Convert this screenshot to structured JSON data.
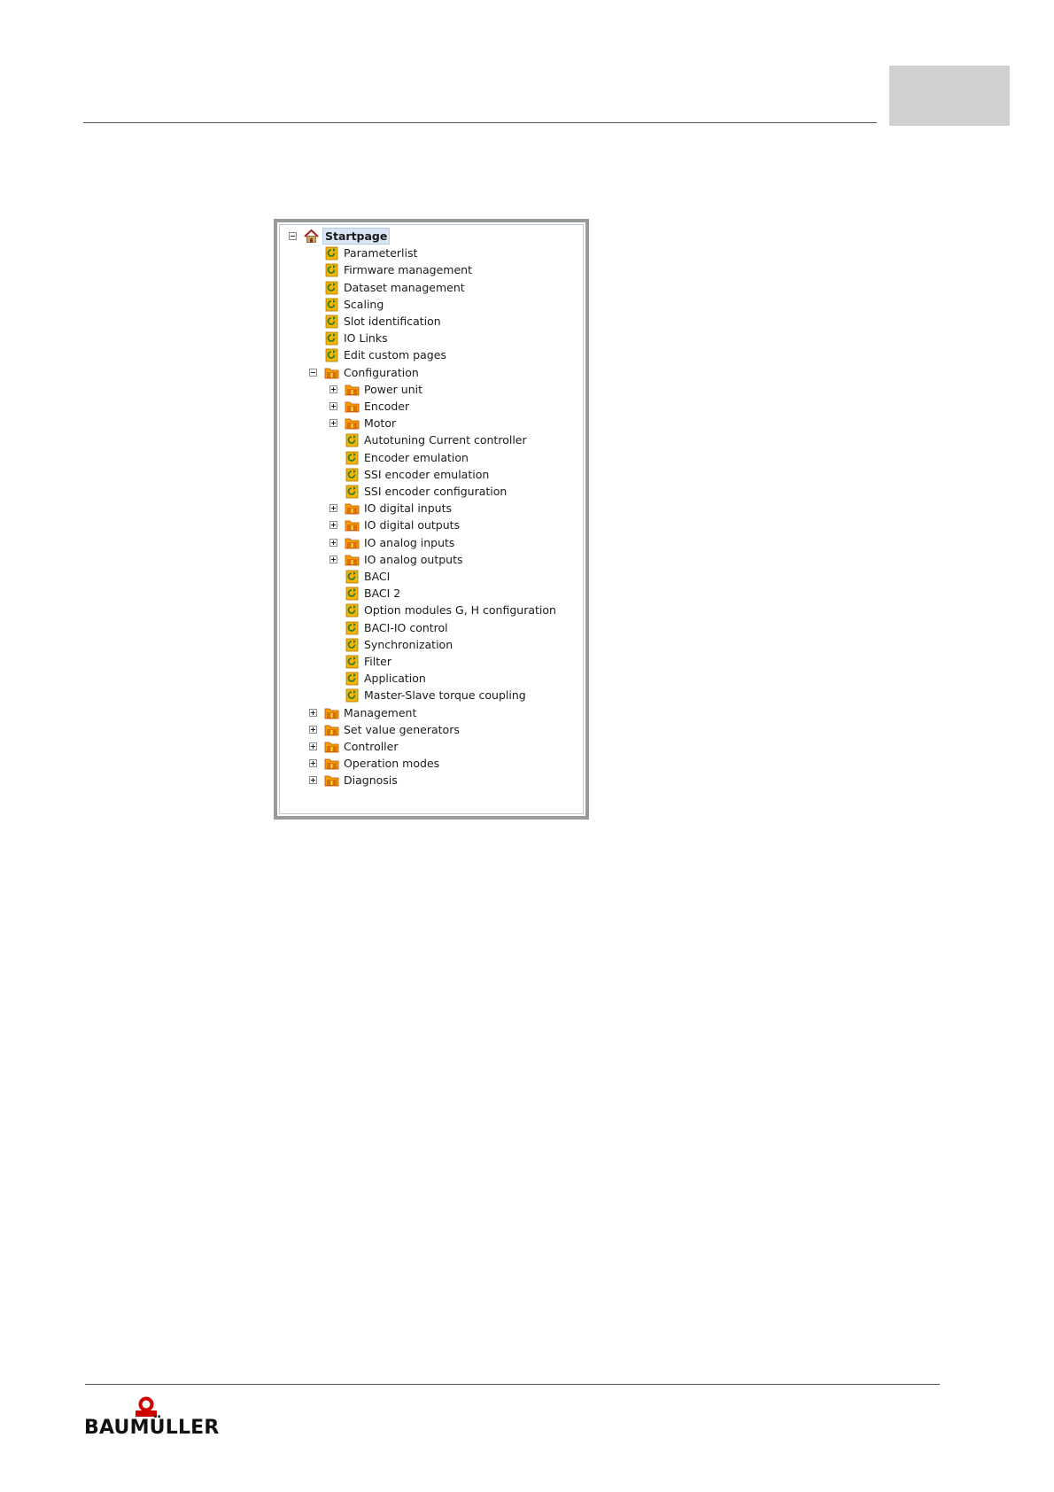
{
  "logo": {
    "text": "BAUMÜLLER"
  },
  "tree": {
    "root": {
      "label": "Startpage",
      "icon": "house-icon",
      "expanded": true
    },
    "items": [
      {
        "label": "Parameterlist",
        "icon": "page-icon",
        "level": 1,
        "toggle": "none"
      },
      {
        "label": "Firmware management",
        "icon": "page-icon",
        "level": 1,
        "toggle": "none"
      },
      {
        "label": "Dataset management",
        "icon": "page-icon",
        "level": 1,
        "toggle": "none"
      },
      {
        "label": "Scaling",
        "icon": "page-icon",
        "level": 1,
        "toggle": "none"
      },
      {
        "label": "Slot identification",
        "icon": "page-icon",
        "level": 1,
        "toggle": "none"
      },
      {
        "label": "IO Links",
        "icon": "page-icon",
        "level": 1,
        "toggle": "none"
      },
      {
        "label": "Edit custom pages",
        "icon": "page-icon",
        "level": 1,
        "toggle": "none"
      },
      {
        "label": "Configuration",
        "icon": "folder-icon",
        "level": 1,
        "toggle": "minus"
      },
      {
        "label": "Power unit",
        "icon": "folder-icon",
        "level": 2,
        "toggle": "plus"
      },
      {
        "label": "Encoder",
        "icon": "folder-icon",
        "level": 2,
        "toggle": "plus"
      },
      {
        "label": "Motor",
        "icon": "folder-icon",
        "level": 2,
        "toggle": "plus"
      },
      {
        "label": "Autotuning Current controller",
        "icon": "page-icon",
        "level": 2,
        "toggle": "none"
      },
      {
        "label": "Encoder emulation",
        "icon": "page-icon",
        "level": 2,
        "toggle": "none"
      },
      {
        "label": "SSI encoder emulation",
        "icon": "page-icon",
        "level": 2,
        "toggle": "none"
      },
      {
        "label": "SSI encoder configuration",
        "icon": "page-icon",
        "level": 2,
        "toggle": "none"
      },
      {
        "label": "IO digital inputs",
        "icon": "folder-icon",
        "level": 2,
        "toggle": "plus"
      },
      {
        "label": "IO digital outputs",
        "icon": "folder-icon",
        "level": 2,
        "toggle": "plus"
      },
      {
        "label": "IO analog inputs",
        "icon": "folder-icon",
        "level": 2,
        "toggle": "plus"
      },
      {
        "label": "IO analog outputs",
        "icon": "folder-icon",
        "level": 2,
        "toggle": "plus"
      },
      {
        "label": "BACI",
        "icon": "page-icon",
        "level": 2,
        "toggle": "none"
      },
      {
        "label": "BACI 2",
        "icon": "page-icon",
        "level": 2,
        "toggle": "none"
      },
      {
        "label": "Option modules G, H configuration",
        "icon": "page-icon",
        "level": 2,
        "toggle": "none"
      },
      {
        "label": "BACI-IO control",
        "icon": "page-icon",
        "level": 2,
        "toggle": "none"
      },
      {
        "label": "Synchronization",
        "icon": "page-icon",
        "level": 2,
        "toggle": "none"
      },
      {
        "label": "Filter",
        "icon": "page-icon",
        "level": 2,
        "toggle": "none"
      },
      {
        "label": "Application",
        "icon": "page-icon",
        "level": 2,
        "toggle": "none"
      },
      {
        "label": "Master-Slave torque coupling",
        "icon": "page-icon",
        "level": 2,
        "toggle": "none"
      },
      {
        "label": "Management",
        "icon": "folder-icon",
        "level": 1,
        "toggle": "plus"
      },
      {
        "label": "Set value generators",
        "icon": "folder-icon",
        "level": 1,
        "toggle": "plus"
      },
      {
        "label": "Controller",
        "icon": "folder-icon",
        "level": 1,
        "toggle": "plus"
      },
      {
        "label": "Operation modes",
        "icon": "folder-icon",
        "level": 1,
        "toggle": "plus"
      },
      {
        "label": "Diagnosis",
        "icon": "folder-icon",
        "level": 1,
        "toggle": "plus"
      }
    ]
  },
  "colors": {
    "folder": "#f5a000",
    "folder_dark": "#c84a00",
    "page_bg": "#f4b400",
    "page_mark": "#2e7d2e",
    "selection": "#dbe6f4",
    "logo_red": "#d00000"
  }
}
